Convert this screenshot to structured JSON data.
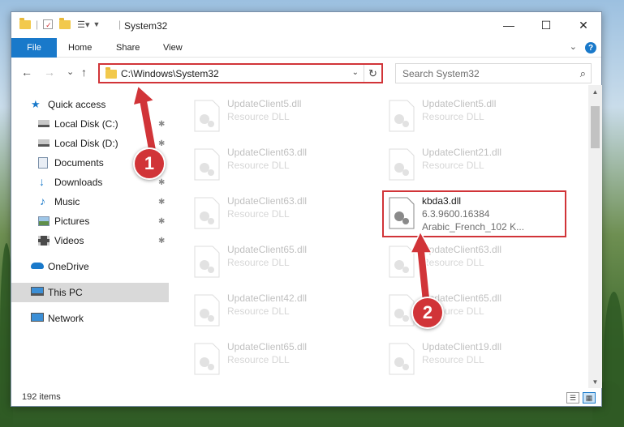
{
  "window": {
    "title": "System32",
    "minimize_glyph": "—",
    "maximize_glyph": "☐",
    "close_glyph": "✕"
  },
  "ribbon": {
    "tabs": [
      "File",
      "Home",
      "Share",
      "View"
    ],
    "collapse_glyph": "⌄",
    "help_glyph": "?"
  },
  "navigation": {
    "back_glyph": "←",
    "forward_glyph": "→",
    "recent_glyph": "⌄",
    "up_glyph": "↑",
    "address": "C:\\Windows\\System32",
    "address_dropdown_glyph": "⌄",
    "refresh_glyph": "↻"
  },
  "search": {
    "placeholder": "Search System32",
    "icon_glyph": "⌕"
  },
  "sidebar": {
    "items": [
      {
        "label": "Quick access",
        "icon": "star-icon",
        "pinned": false
      },
      {
        "label": "Local Disk (C:)",
        "icon": "drive-icon",
        "pinned": true
      },
      {
        "label": "Local Disk (D:)",
        "icon": "drive-icon",
        "pinned": true
      },
      {
        "label": "Documents",
        "icon": "documents-icon",
        "pinned": true
      },
      {
        "label": "Downloads",
        "icon": "download-icon",
        "pinned": true
      },
      {
        "label": "Music",
        "icon": "music-icon",
        "pinned": true
      },
      {
        "label": "Pictures",
        "icon": "pictures-icon",
        "pinned": true
      },
      {
        "label": "Videos",
        "icon": "videos-icon",
        "pinned": true
      },
      {
        "label": "OneDrive",
        "icon": "cloud-icon",
        "pinned": false
      },
      {
        "label": "This PC",
        "icon": "computer-icon",
        "pinned": false,
        "selected": true
      },
      {
        "label": "Network",
        "icon": "network-icon",
        "pinned": false
      }
    ],
    "pin_glyph": "📌"
  },
  "files": {
    "left_column": [
      {
        "name": "UpdateClient5.dll",
        "type": "Resource DLL"
      },
      {
        "name": "UpdateClient63.dll",
        "type": "Resource DLL"
      },
      {
        "name": "UpdateClient63.dll",
        "type": "Resource DLL"
      },
      {
        "name": "UpdateClient65.dll",
        "type": "Resource DLL"
      },
      {
        "name": "UpdateClient42.dll",
        "type": "Resource DLL"
      },
      {
        "name": "UpdateClient65.dll",
        "type": "Resource DLL"
      }
    ],
    "right_column": [
      {
        "name": "UpdateClient5.dll",
        "type": "Resource DLL"
      },
      {
        "name": "UpdateClient21.dll",
        "type": "Resource DLL"
      },
      {
        "name": "kbda3.dll",
        "version": "6.3.9600.16384",
        "description": "Arabic_French_102 K...",
        "highlighted": true
      },
      {
        "name": "UpdateClient63.dll",
        "type": "Resource DLL"
      },
      {
        "name": "UpdateClient65.dll",
        "type": "Resource DLL"
      },
      {
        "name": "UpdateClient19.dll",
        "type": "Resource DLL"
      }
    ]
  },
  "status": {
    "items_count": "192 items"
  },
  "annotations": {
    "step1": "1",
    "step2": "2",
    "color": "#d13438"
  },
  "colors": {
    "accent": "#1979ca",
    "highlight": "#d13438",
    "folder": "#f2c94c"
  }
}
